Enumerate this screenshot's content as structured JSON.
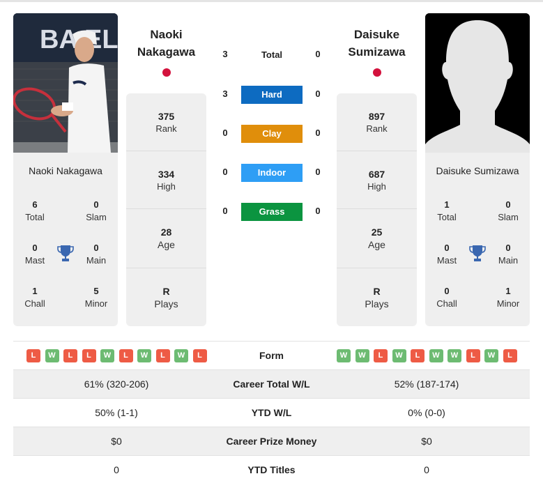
{
  "colors": {
    "hard": "#0d6bc1",
    "clay": "#e08e0b",
    "indoor": "#2e9ef5",
    "grass": "#0b9440",
    "win": "#6dbb72",
    "loss": "#ee5b45",
    "trophy": "#3a67b0",
    "flag_japan": "#d3123d"
  },
  "player1": {
    "name_line1": "Naoki",
    "name_line2": "Nakagawa",
    "full_name": "Naoki Nakagawa",
    "country": "Japan",
    "photo": "player-photo",
    "titles": {
      "total": {
        "value": "6",
        "label": "Total"
      },
      "slam": {
        "value": "0",
        "label": "Slam"
      },
      "mast": {
        "value": "0",
        "label": "Mast"
      },
      "main": {
        "value": "0",
        "label": "Main"
      },
      "chall": {
        "value": "1",
        "label": "Chall"
      },
      "minor": {
        "value": "5",
        "label": "Minor"
      }
    },
    "stats": {
      "rank": {
        "value": "375",
        "label": "Rank"
      },
      "high": {
        "value": "334",
        "label": "High"
      },
      "age": {
        "value": "28",
        "label": "Age"
      },
      "plays": {
        "value": "R",
        "label": "Plays"
      }
    }
  },
  "player2": {
    "name_line1": "Daisuke",
    "name_line2": "Sumizawa",
    "full_name": "Daisuke Sumizawa",
    "country": "Japan",
    "photo": "silhouette-placeholder",
    "titles": {
      "total": {
        "value": "1",
        "label": "Total"
      },
      "slam": {
        "value": "0",
        "label": "Slam"
      },
      "mast": {
        "value": "0",
        "label": "Mast"
      },
      "main": {
        "value": "0",
        "label": "Main"
      },
      "chall": {
        "value": "0",
        "label": "Chall"
      },
      "minor": {
        "value": "1",
        "label": "Minor"
      }
    },
    "stats": {
      "rank": {
        "value": "897",
        "label": "Rank"
      },
      "high": {
        "value": "687",
        "label": "High"
      },
      "age": {
        "value": "25",
        "label": "Age"
      },
      "plays": {
        "value": "R",
        "label": "Plays"
      }
    }
  },
  "h2h": [
    {
      "label": "Total",
      "p1": "3",
      "p2": "0",
      "surface": "total"
    },
    {
      "label": "Hard",
      "p1": "3",
      "p2": "0",
      "surface": "hard"
    },
    {
      "label": "Clay",
      "p1": "0",
      "p2": "0",
      "surface": "clay"
    },
    {
      "label": "Indoor",
      "p1": "0",
      "p2": "0",
      "surface": "indoor"
    },
    {
      "label": "Grass",
      "p1": "0",
      "p2": "0",
      "surface": "grass"
    }
  ],
  "comparison": {
    "form": {
      "label": "Form",
      "p1": [
        "L",
        "W",
        "L",
        "L",
        "W",
        "L",
        "W",
        "L",
        "W",
        "L"
      ],
      "p2": [
        "W",
        "W",
        "L",
        "W",
        "L",
        "W",
        "W",
        "L",
        "W",
        "L"
      ]
    },
    "rows": [
      {
        "label": "Career Total W/L",
        "p1": "61% (320-206)",
        "p2": "52% (187-174)"
      },
      {
        "label": "YTD W/L",
        "p1": "50% (1-1)",
        "p2": "0% (0-0)"
      },
      {
        "label": "Career Prize Money",
        "p1": "$0",
        "p2": "$0"
      },
      {
        "label": "YTD Titles",
        "p1": "0",
        "p2": "0"
      }
    ]
  }
}
